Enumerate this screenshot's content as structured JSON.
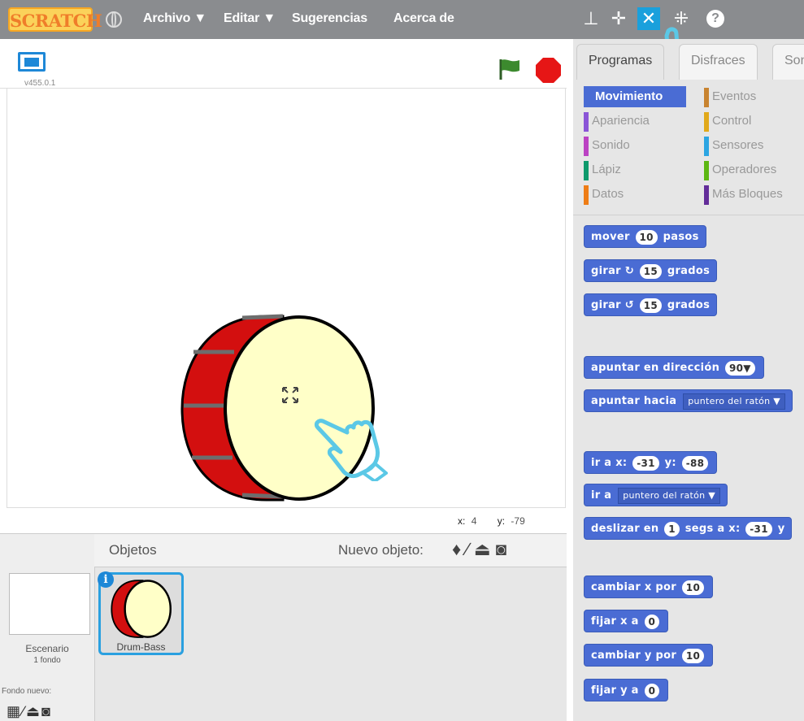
{
  "menubar": {
    "logo": "SCRATCH",
    "items": [
      "Archivo ▼",
      "Editar ▼",
      "Sugerencias",
      "Acerca de"
    ]
  },
  "stage": {
    "version": "v455.0.1",
    "x_label": "x:",
    "x_value": "4",
    "y_label": "y:",
    "y_value": "-79"
  },
  "sprites": {
    "title": "Objetos",
    "nuevo_objeto": "Nuevo objeto:",
    "stage_label": "Escenario",
    "stage_count": "1 fondo",
    "fondo_nuevo": "Fondo nuevo:",
    "sprite_name": "Drum-Bass"
  },
  "tabs": [
    "Programas",
    "Disfraces",
    "Sonidos"
  ],
  "categories": {
    "left": [
      "Movimiento",
      "Apariencia",
      "Sonido",
      "Lápiz",
      "Datos"
    ],
    "right": [
      "Eventos",
      "Control",
      "Sensores",
      "Operadores",
      "Más Bloques"
    ],
    "colors": {
      "Movimiento": "#4a6cd4",
      "Apariencia": "#8a55d7",
      "Sonido": "#bb42c3",
      "Lápiz": "#0e9a6c",
      "Datos": "#ee7d16",
      "Eventos": "#c88330",
      "Control": "#e1a91a",
      "Sensores": "#2ca5e2",
      "Operadores": "#5cb712",
      "Más Bloques": "#632d99"
    }
  },
  "blocks": {
    "mover": {
      "a": "mover",
      "n": "10",
      "b": "pasos"
    },
    "girar_r": {
      "a": "girar",
      "n": "15",
      "b": "grados"
    },
    "girar_l": {
      "a": "girar",
      "n": "15",
      "b": "grados"
    },
    "apuntar_dir": {
      "a": "apuntar en dirección",
      "n": "90▼"
    },
    "apuntar_hacia": {
      "a": "apuntar hacia",
      "d": "puntero del ratón ▼"
    },
    "ir_xy": {
      "a": "ir a x:",
      "x": "-31",
      "b": "y:",
      "y": "-88"
    },
    "ir_a": {
      "a": "ir a",
      "d": "puntero del ratón ▼"
    },
    "deslizar": {
      "a": "deslizar en",
      "n": "1",
      "b": "segs a x:",
      "x": "-31",
      "c": "y"
    },
    "cambiar_x": {
      "a": "cambiar x por",
      "n": "10"
    },
    "fijar_x": {
      "a": "fijar x a",
      "n": "0"
    },
    "cambiar_y": {
      "a": "cambiar y por",
      "n": "10"
    },
    "fijar_y": {
      "a": "fijar y a",
      "n": "0"
    }
  }
}
